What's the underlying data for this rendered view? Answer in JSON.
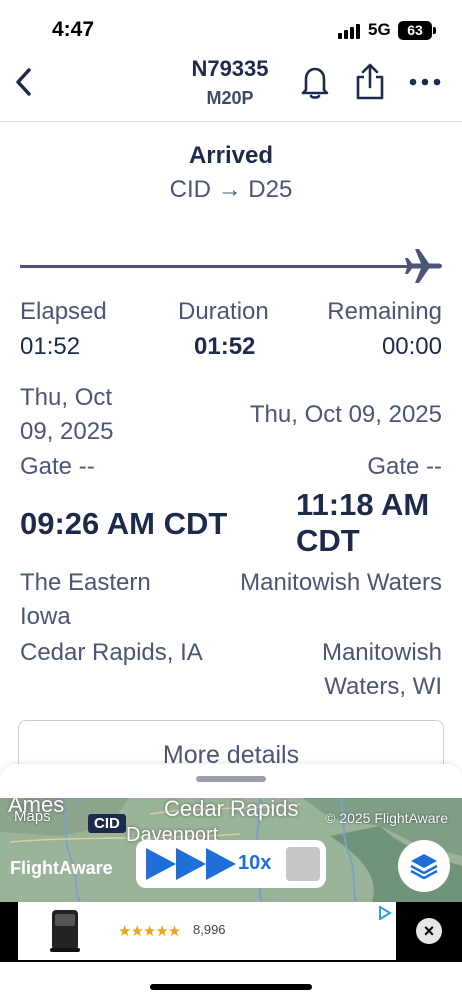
{
  "status_bar": {
    "time": "4:47",
    "network": "5G",
    "battery": "63"
  },
  "header": {
    "title": "N79335",
    "subtitle": "M20P"
  },
  "flight": {
    "status": "Arrived",
    "route": "CID → D25",
    "elapsed_label": "Elapsed",
    "elapsed_value": "01:52",
    "duration_label": "Duration",
    "duration_value": "01:52",
    "remaining_label": "Remaining",
    "remaining_value": "00:00",
    "progress_fraction": 1.0
  },
  "departure": {
    "date_line1": "Thu, Oct",
    "date_line2": "09, 2025",
    "gate": "Gate --",
    "time": "09:26 AM CDT",
    "airport_line1": "The Eastern",
    "airport_line2": "Iowa",
    "city": "Cedar Rapids, IA"
  },
  "arrival": {
    "date": "Thu, Oct 09, 2025",
    "gate": "Gate --",
    "time_line1": "11:18 AM",
    "time_line2": "CDT",
    "airport": "Manitowish Waters",
    "city_line1": "Manitowish",
    "city_line2": "Waters, WI"
  },
  "more_details_label": "More details",
  "map": {
    "label_ames": "Ames",
    "label_cedar_rapids": "Cedar Rapids",
    "label_davenport": "Davenport",
    "maps_credit": "Maps",
    "copyright": "© 2025 FlightAware",
    "airport_tag": "CID",
    "logo": "FlightAware",
    "speed": "10x"
  },
  "ad": {
    "rating_count": "8,996"
  },
  "colors": {
    "navy": "#1d2a4a",
    "slate": "#4a5673",
    "accent_blue": "#1f6fd8"
  }
}
